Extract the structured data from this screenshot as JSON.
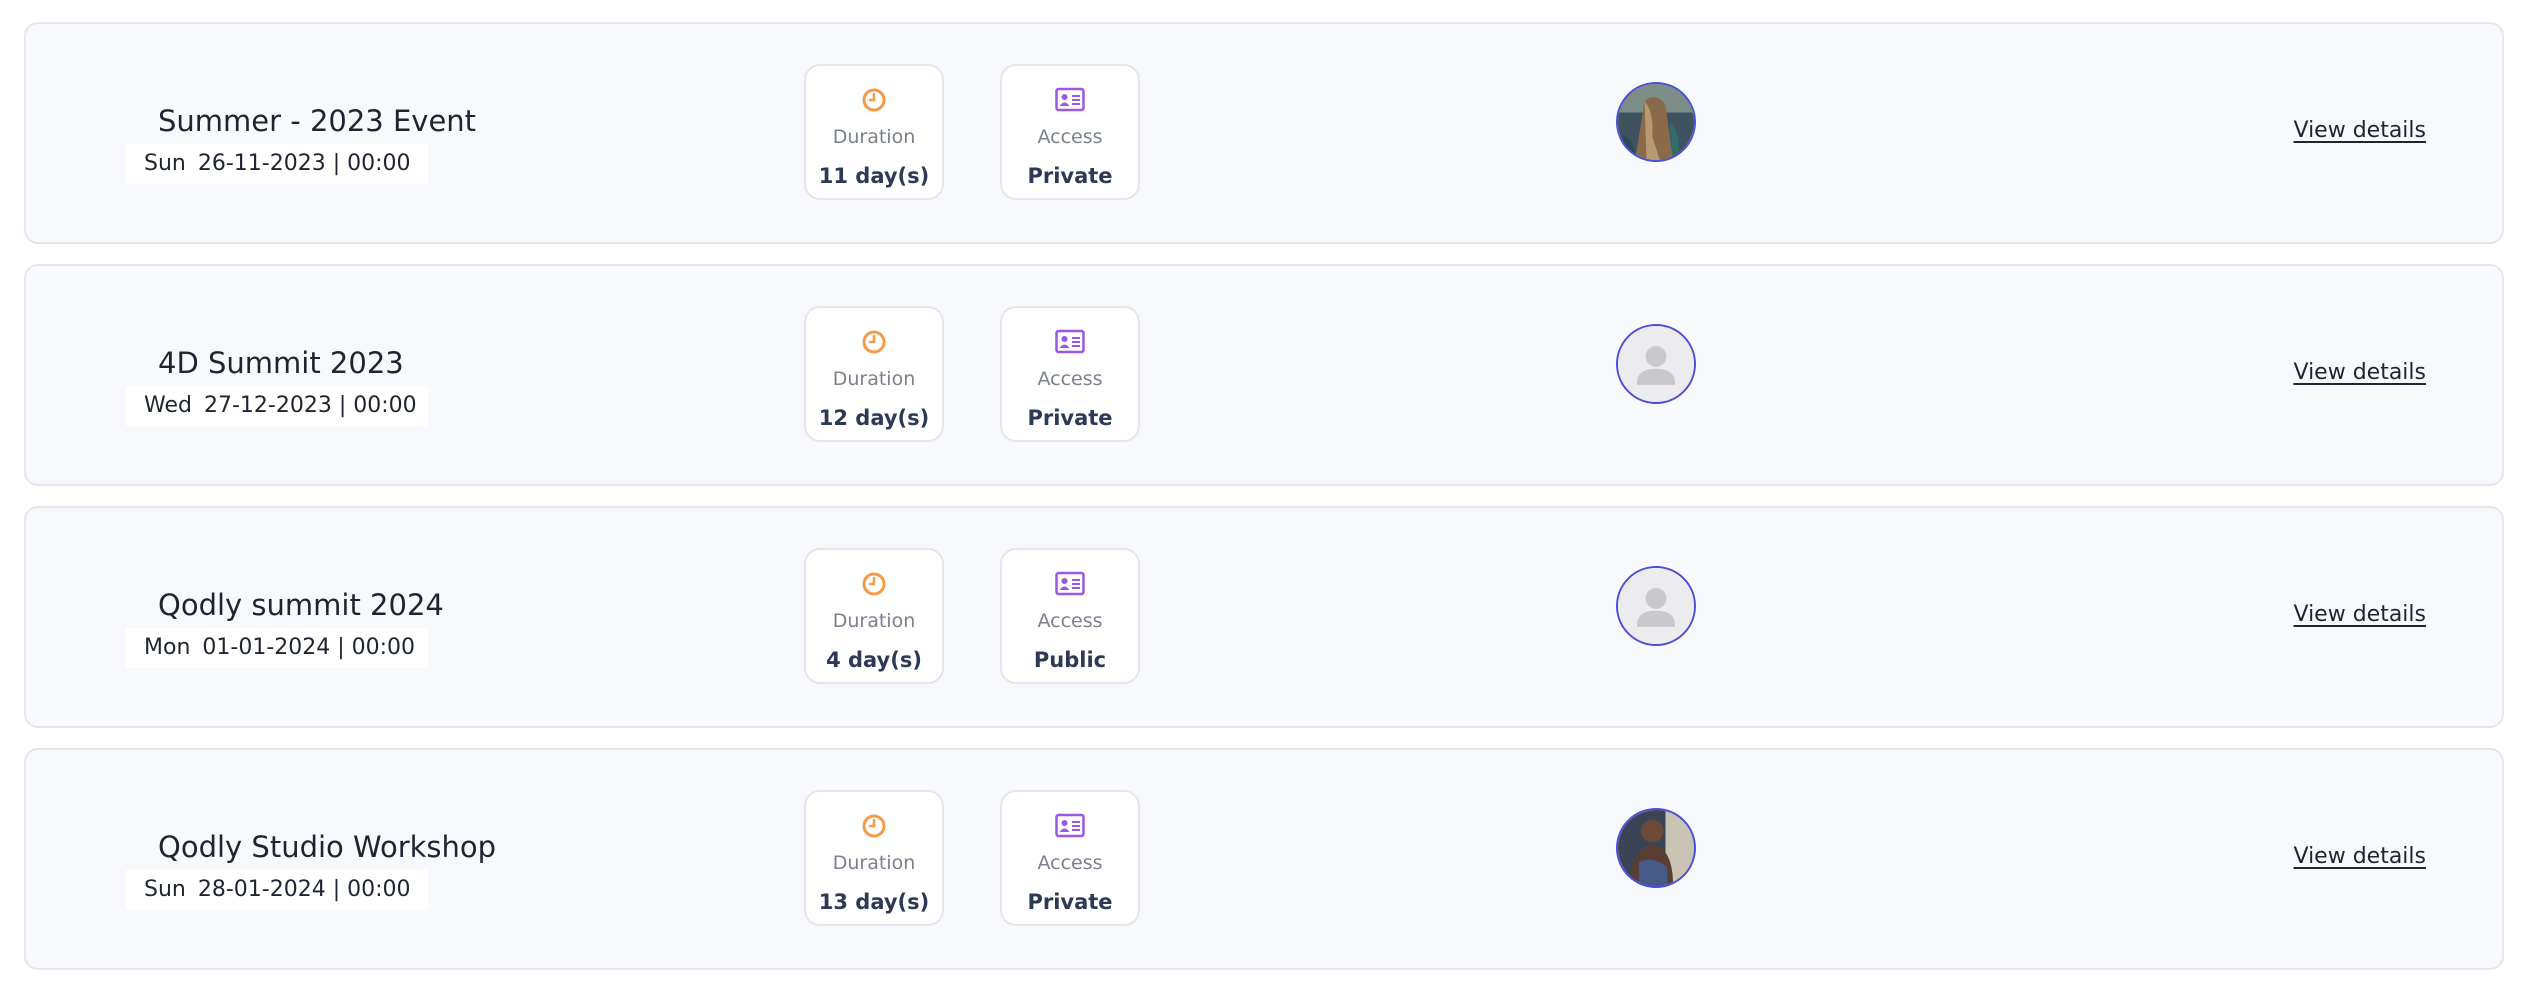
{
  "events": [
    {
      "title": "Summer - 2023 Event",
      "day": "Sun",
      "datetime": "26-11-2023 | 00:00",
      "duration_label": "Duration",
      "duration_value": "11 day(s)",
      "access_label": "Access",
      "access_value": "Private",
      "avatar": "photo-landscape",
      "link": "View details"
    },
    {
      "title": "4D Summit 2023",
      "day": "Wed",
      "datetime": "27-12-2023 | 00:00",
      "duration_label": "Duration",
      "duration_value": "12 day(s)",
      "access_label": "Access",
      "access_value": "Private",
      "avatar": "placeholder-user-icon",
      "link": "View details"
    },
    {
      "title": "Qodly summit 2024",
      "day": "Mon",
      "datetime": "01-01-2024 | 00:00",
      "duration_label": "Duration",
      "duration_value": "4 day(s)",
      "access_label": "Access",
      "access_value": "Public",
      "avatar": "placeholder-user-icon",
      "link": "View details"
    },
    {
      "title": "Qodly Studio Workshop",
      "day": "Sun",
      "datetime": "28-01-2024 | 00:00",
      "duration_label": "Duration",
      "duration_value": "13 day(s)",
      "access_label": "Access",
      "access_value": "Private",
      "avatar": "photo-person",
      "link": "View details"
    }
  ],
  "colors": {
    "clock_icon": "#f59a45",
    "id_card_icon": "#9b57e6",
    "avatar_border": "#4b4fd6",
    "card_background": "#f8f9fc"
  }
}
